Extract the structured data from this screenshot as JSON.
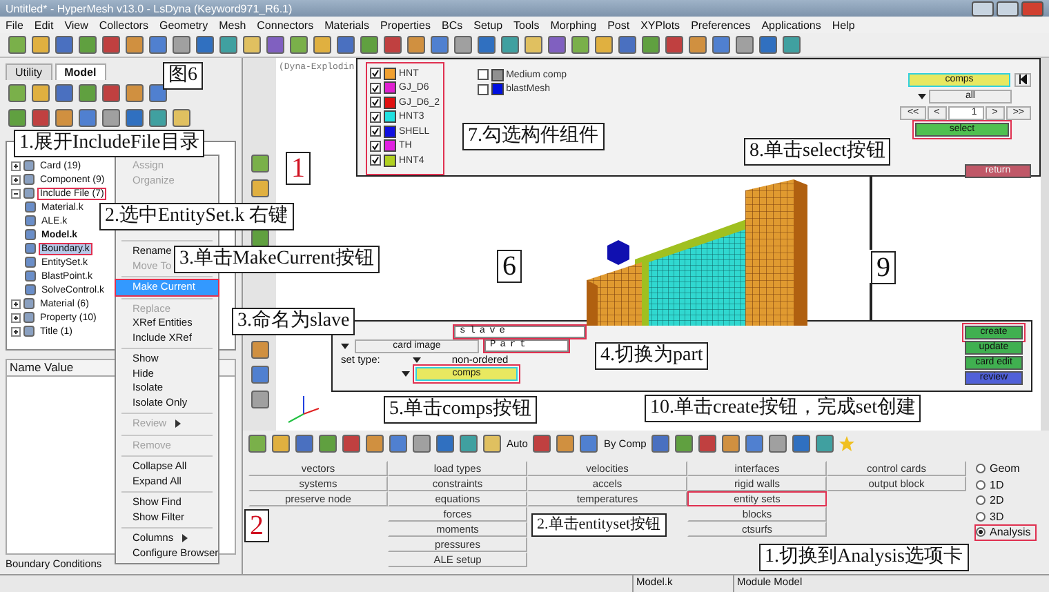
{
  "window": {
    "title": "Untitled* - HyperMesh v13.0 - LsDyna (Keyword971_R6.1)"
  },
  "menu": [
    "File",
    "Edit",
    "View",
    "Collectors",
    "Geometry",
    "Mesh",
    "Connectors",
    "Materials",
    "Properties",
    "BCs",
    "Setup",
    "Tools",
    "Morphing",
    "Post",
    "XYPlots",
    "Preferences",
    "Applications",
    "Help"
  ],
  "browser": {
    "tabs": [
      {
        "label": "Utility",
        "selected": false
      },
      {
        "label": "Model",
        "selected": true
      }
    ],
    "tree": [
      {
        "label": "Card (19)",
        "expanded": false,
        "highlighted": false,
        "selected": false
      },
      {
        "label": "Component (9)",
        "expanded": false,
        "highlighted": false,
        "selected": false
      },
      {
        "label": "Include File (7)",
        "expanded": true,
        "highlighted": true,
        "selected": false,
        "children": [
          {
            "label": "Material.k",
            "current": false,
            "selected": false
          },
          {
            "label": "ALE.k",
            "current": false,
            "selected": false
          },
          {
            "label": "Model.k",
            "current": true,
            "selected": false
          },
          {
            "label": "Boundary.k",
            "current": false,
            "selected": true
          },
          {
            "label": "EntitySet.k",
            "current": false,
            "selected": false
          },
          {
            "label": "BlastPoint.k",
            "current": false,
            "selected": false
          },
          {
            "label": "SolveControl.k",
            "current": false,
            "selected": false
          }
        ]
      },
      {
        "label": "Material (6)",
        "expanded": false,
        "highlighted": false,
        "selected": false
      },
      {
        "label": "Property (10)",
        "expanded": false,
        "highlighted": false,
        "selected": false
      },
      {
        "label": "Title (1)",
        "expanded": false,
        "highlighted": false,
        "selected": false
      }
    ],
    "properties_header": "Name Value",
    "bottom_tab": "Boundary Conditions"
  },
  "context_menu": [
    [
      {
        "label": "Assign",
        "disabled": true,
        "submenu": false,
        "selected": false
      },
      {
        "label": "Organize",
        "disabled": true,
        "submenu": false,
        "selected": false
      }
    ],
    [
      {
        "label": "Rename",
        "disabled": false,
        "submenu": false,
        "selected": false
      },
      {
        "label": "Move To",
        "disabled": true,
        "submenu": false,
        "selected": false
      }
    ],
    [
      {
        "label": "Make Current",
        "disabled": false,
        "submenu": false,
        "selected": true
      }
    ],
    [
      {
        "label": "Replace",
        "disabled": true,
        "submenu": false,
        "selected": false
      },
      {
        "label": "XRef Entities",
        "disabled": false,
        "submenu": false,
        "selected": false
      },
      {
        "label": "Include XRef",
        "disabled": false,
        "submenu": false,
        "selected": false
      }
    ],
    [
      {
        "label": "Show",
        "disabled": false,
        "submenu": false,
        "selected": false
      },
      {
        "label": "Hide",
        "disabled": false,
        "submenu": false,
        "selected": false
      },
      {
        "label": "Isolate",
        "disabled": false,
        "submenu": false,
        "selected": false
      },
      {
        "label": "Isolate Only",
        "disabled": false,
        "submenu": false,
        "selected": false
      }
    ],
    [
      {
        "label": "Review",
        "disabled": true,
        "submenu": true,
        "selected": false
      }
    ],
    [
      {
        "label": "Remove",
        "disabled": true,
        "submenu": false,
        "selected": false
      }
    ],
    [
      {
        "label": "Collapse All",
        "disabled": false,
        "submenu": false,
        "selected": false
      },
      {
        "label": "Expand All",
        "disabled": false,
        "submenu": false,
        "selected": false
      }
    ],
    [
      {
        "label": "Show Find",
        "disabled": false,
        "submenu": false,
        "selected": false
      },
      {
        "label": "Show Filter",
        "disabled": false,
        "submenu": false,
        "selected": false
      }
    ],
    [
      {
        "label": "Columns",
        "disabled": false,
        "submenu": true,
        "selected": false
      },
      {
        "label": "Configure Browser",
        "disabled": false,
        "submenu": false,
        "selected": false
      }
    ]
  ],
  "graphics": {
    "model_title": "(Dyna-Explodin"
  },
  "components": [
    {
      "name": "HNT",
      "checked": true,
      "color": "#f0a030"
    },
    {
      "name": "GJ_D6",
      "checked": true,
      "color": "#e020d0"
    },
    {
      "name": "GJ_D6_2",
      "checked": true,
      "color": "#e01010"
    },
    {
      "name": "HNT3",
      "checked": true,
      "color": "#20e0e0"
    },
    {
      "name": "SHELL",
      "checked": true,
      "color": "#1010e0"
    },
    {
      "name": "TH",
      "checked": true,
      "color": "#e020e0"
    },
    {
      "name": "HNT4",
      "checked": true,
      "color": "#b0d020"
    }
  ],
  "other_components": [
    {
      "name": "Medium comp",
      "checked": false,
      "color": "#909090"
    },
    {
      "name": "blastMesh",
      "checked": false,
      "color": "#0010e0"
    }
  ],
  "selector": {
    "collector": "comps",
    "filter": "all",
    "nav": [
      "<<",
      "<",
      ">",
      ">>"
    ],
    "page": "1",
    "select": "select",
    "return": "return"
  },
  "set_panel": {
    "name": "slave",
    "card_image_label": "card image",
    "card_image": "Part",
    "set_type_label": "set type:",
    "set_type": "non-ordered",
    "collector": "comps",
    "buttons": [
      {
        "label": "create",
        "kind": "green"
      },
      {
        "label": "update",
        "kind": "green"
      },
      {
        "label": "card edit",
        "kind": "green"
      },
      {
        "label": "review",
        "kind": "blue"
      }
    ]
  },
  "toolbar": {
    "display_mode": "Auto",
    "color_mode": "By Comp"
  },
  "menu_grid": [
    [
      {
        "label": "vectors",
        "highlighted": false
      },
      {
        "label": "systems",
        "highlighted": false
      },
      {
        "label": "preserve node",
        "highlighted": false
      }
    ],
    [
      {
        "label": "load types",
        "highlighted": false
      },
      {
        "label": "constraints",
        "highlighted": false
      },
      {
        "label": "equations",
        "highlighted": false
      },
      {
        "label": "forces",
        "highlighted": false
      },
      {
        "label": "moments",
        "highlighted": false
      },
      {
        "label": "pressures",
        "highlighted": false
      },
      {
        "label": "ALE setup",
        "highlighted": false
      }
    ],
    [
      {
        "label": "velocities",
        "highlighted": false
      },
      {
        "label": "accels",
        "highlighted": false
      },
      {
        "label": "temperatures",
        "highlighted": false
      }
    ],
    [
      {
        "label": "interfaces",
        "highlighted": false
      },
      {
        "label": "rigid walls",
        "highlighted": false
      },
      {
        "label": "entity sets",
        "highlighted": true
      },
      {
        "label": "blocks",
        "highlighted": false
      },
      {
        "label": "ctsurfs",
        "highlighted": false
      }
    ],
    [
      {
        "label": "control cards",
        "highlighted": false
      },
      {
        "label": "output block",
        "highlighted": false
      }
    ]
  ],
  "page_tabs": [
    {
      "label": "Geom",
      "selected": false
    },
    {
      "label": "1D",
      "selected": false
    },
    {
      "label": "2D",
      "selected": false
    },
    {
      "label": "3D",
      "selected": false
    },
    {
      "label": "Analysis",
      "selected": true
    }
  ],
  "status_bar": [
    "Model.k",
    "Module Model"
  ],
  "annotations": [
    {
      "text": "图6",
      "kind": "note"
    },
    {
      "text": "1.展开IncludeFile目录",
      "kind": "note"
    },
    {
      "text": "7.勾选构件组件",
      "kind": "note"
    },
    {
      "text": "8.单击select按钮",
      "kind": "note"
    },
    {
      "text": "1",
      "kind": "marker"
    },
    {
      "text": "2.选中EntitySet.k 右键",
      "kind": "note"
    },
    {
      "text": "3.单击MakeCurrent按钮",
      "kind": "note"
    },
    {
      "text": "6",
      "kind": "step"
    },
    {
      "text": "9",
      "kind": "step"
    },
    {
      "text": "3.命名为slave",
      "kind": "note"
    },
    {
      "text": "4.切换为part",
      "kind": "note"
    },
    {
      "text": "5.单击comps按钮",
      "kind": "note"
    },
    {
      "text": "10.单击create按钮，完成set创建",
      "kind": "note"
    },
    {
      "text": "2",
      "kind": "marker"
    },
    {
      "text": "2.单击entityset按钮",
      "kind": "note"
    },
    {
      "text": "1.切换到Analysis选项卡",
      "kind": "note"
    }
  ]
}
